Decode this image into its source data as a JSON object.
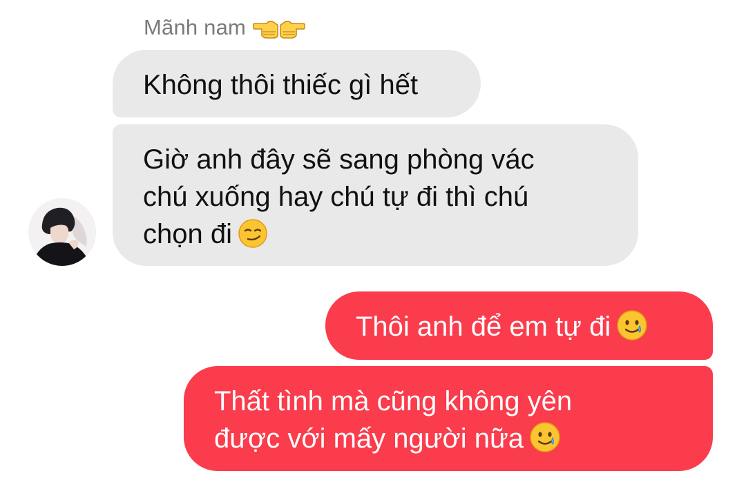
{
  "sender": {
    "name": "Mãnh nam",
    "name_emoji": "pointing-hands-icon"
  },
  "messages": [
    {
      "direction": "incoming",
      "lines": [
        "Không thôi thiếc gì hết"
      ],
      "emoji": ""
    },
    {
      "direction": "incoming",
      "lines": [
        "Giờ anh đây sẽ sang phòng vác",
        "chú xuống hay chú tự đi thì chú",
        "chọn đi"
      ],
      "emoji": "smirking-face-icon"
    },
    {
      "direction": "outgoing",
      "lines": [
        "Thôi anh để em tự đi"
      ],
      "emoji": "smiling-face-with-tear-icon"
    },
    {
      "direction": "outgoing",
      "lines": [
        "Thất tình mà cũng không yên",
        "được với mấy người nữa"
      ],
      "emoji": "smiling-face-with-tear-icon"
    }
  ],
  "colors": {
    "incoming_bubble": "#e9e9e9",
    "outgoing_bubble": "#fa3c4c",
    "sender_name": "#7a7a7a"
  }
}
